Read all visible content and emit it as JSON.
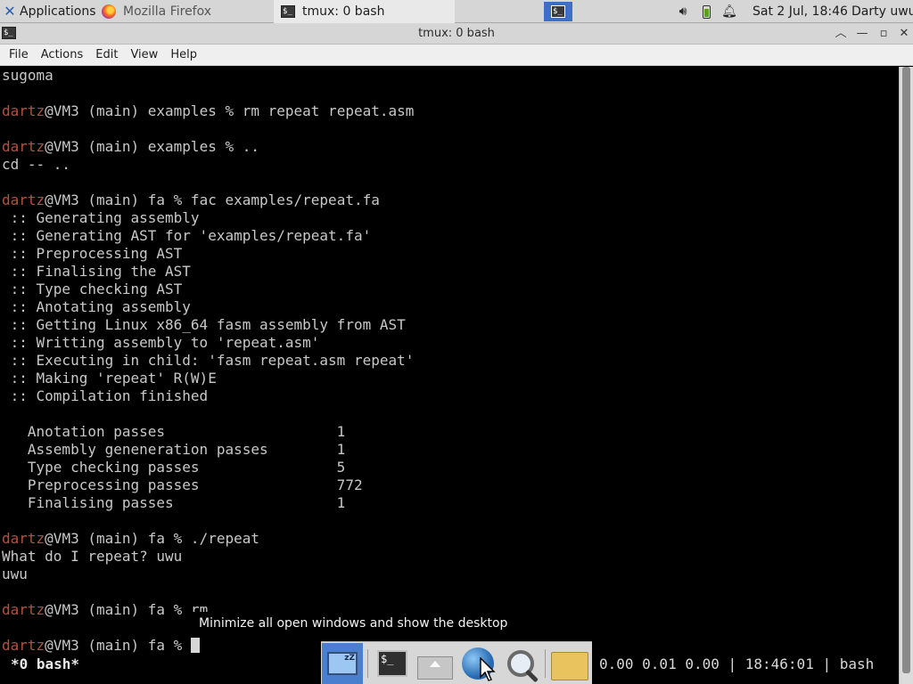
{
  "top_panel": {
    "applications_label": "Applications",
    "tasks": [
      {
        "label": "Mozilla Firefox"
      },
      {
        "label": "tmux: 0 bash"
      }
    ],
    "clock": "Sat  2 Jul, 18:46",
    "user": "Darty uwu"
  },
  "window": {
    "title": "tmux: 0 bash",
    "menu": [
      "File",
      "Actions",
      "Edit",
      "View",
      "Help"
    ]
  },
  "terminal": {
    "lines": [
      {
        "text": "sugoma"
      },
      {
        "text": ""
      },
      {
        "user": "dartz",
        "text": "@VM3 (main) examples % rm repeat repeat.asm"
      },
      {
        "text": ""
      },
      {
        "user": "dartz",
        "text": "@VM3 (main) examples % .."
      },
      {
        "text": "cd -- .."
      },
      {
        "text": ""
      },
      {
        "user": "dartz",
        "text": "@VM3 (main) fa % fac examples/repeat.fa"
      },
      {
        "text": " :: Generating assembly"
      },
      {
        "text": " :: Generating AST for 'examples/repeat.fa'"
      },
      {
        "text": " :: Preprocessing AST"
      },
      {
        "text": " :: Finalising the AST"
      },
      {
        "text": " :: Type checking AST"
      },
      {
        "text": " :: Anotating assembly"
      },
      {
        "text": " :: Getting Linux x86_64 fasm assembly from AST"
      },
      {
        "text": " :: Writting assembly to 'repeat.asm'"
      },
      {
        "text": " :: Executing in child: 'fasm repeat.asm repeat'"
      },
      {
        "text": " :: Making 'repeat' R(W)E"
      },
      {
        "text": " :: Compilation finished"
      },
      {
        "text": ""
      },
      {
        "text": "   Anotation passes                    1"
      },
      {
        "text": "   Assembly geneneration passes        1"
      },
      {
        "text": "   Type checking passes                5"
      },
      {
        "text": "   Preprocessing passes                772"
      },
      {
        "text": "   Finalising passes                   1"
      },
      {
        "text": ""
      },
      {
        "user": "dartz",
        "text": "@VM3 (main) fa % ./repeat"
      },
      {
        "text": "What do I repeat? uwu"
      },
      {
        "text": "uwu"
      },
      {
        "text": ""
      },
      {
        "user": "dartz",
        "text": "@VM3 (main) fa % rm"
      },
      {
        "text": ""
      },
      {
        "user": "dartz",
        "text": "@VM3 (main) fa % ",
        "cursor": true
      }
    ]
  },
  "tmux_status": {
    "left": "*0 bash*",
    "right": "0.00 0.01 0.00 | 18:46:01 | bash"
  },
  "tooltip": "Minimize all open windows and show the desktop",
  "icons": {
    "apps": "xfce-icon",
    "firefox": "firefox-icon",
    "terminal": "terminal-icon",
    "volume": "volume-icon",
    "battery": "battery-icon",
    "notifications": "bell-icon"
  },
  "colors": {
    "prompt_user": "#b3533f",
    "terminal_bg": "#000000",
    "terminal_fg": "#c8c8c8",
    "active_workspace": "#3c6fc7"
  }
}
